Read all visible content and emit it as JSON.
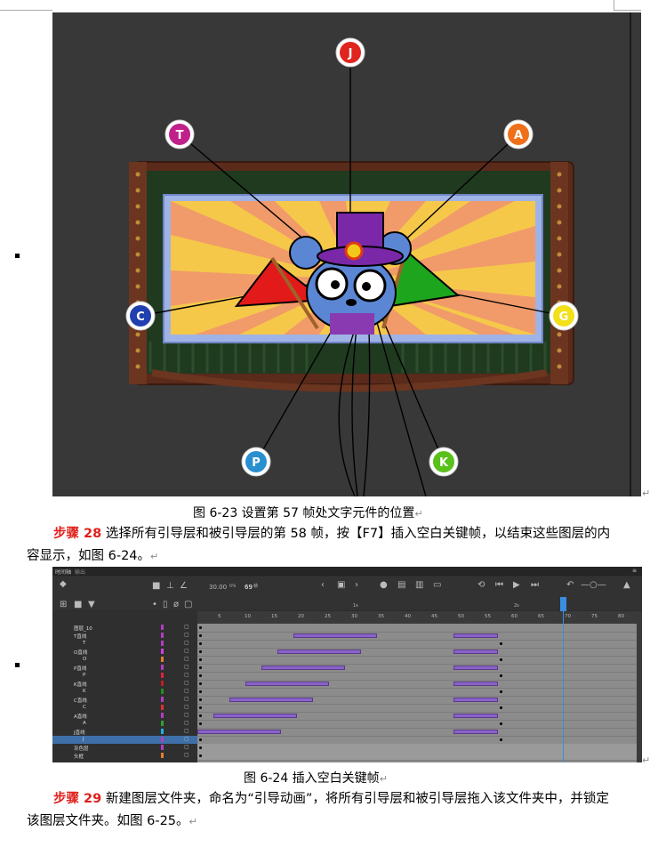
{
  "figure1": {
    "caption": "图 6-23 设置第 57 帧处文字元件的位置",
    "letters": [
      "J",
      "T",
      "A",
      "C",
      "G",
      "P",
      "K"
    ]
  },
  "step28": {
    "label": "步骤 28",
    "text": "选择所有引导层和被引导层的第 58 帧，按【F7】插入空白关键帧，以结束这些图层的内容显示，如图 6-24。"
  },
  "figure2": {
    "caption": "图 6-24 插入空白关键帧",
    "tabs": [
      "时间轴",
      "输出"
    ],
    "fps": "30.00",
    "fps_unit": "FPS",
    "frame": "69",
    "frame_unit": "帧",
    "ruler": [
      "5",
      "10",
      "15",
      "20",
      "25",
      "30",
      "35",
      "40",
      "45",
      "50",
      "55",
      "60",
      "65",
      "70",
      "75",
      "80"
    ],
    "sec_marks": [
      "1s",
      "2s"
    ],
    "layers": [
      {
        "name": "图层_10",
        "color": "#b040c0"
      },
      {
        "name": "T直线",
        "color": "#b040c0"
      },
      {
        "name": "T",
        "color": "#b040c0"
      },
      {
        "name": "O直线",
        "color": "#d040e0"
      },
      {
        "name": "O",
        "color": "#e08030"
      },
      {
        "name": "P直线",
        "color": "#b040c0"
      },
      {
        "name": "P",
        "color": "#e02040"
      },
      {
        "name": "K直线",
        "color": "#c02020"
      },
      {
        "name": "K",
        "color": "#209020"
      },
      {
        "name": "C直线",
        "color": "#b040c0"
      },
      {
        "name": "C",
        "color": "#e03030"
      },
      {
        "name": "A直线",
        "color": "#b040c0"
      },
      {
        "name": "A",
        "color": "#30a030"
      },
      {
        "name": "J直线",
        "color": "#20b0e0"
      },
      {
        "name": "J",
        "color": "#b040c0"
      },
      {
        "name": "灰色层",
        "color": "#b040c0"
      },
      {
        "name": "头框",
        "color": "#e08030"
      }
    ]
  },
  "step29": {
    "label": "步骤 29",
    "text": "新建图层文件夹，命名为“引导动画”，将所有引导层和被引导层拖入该文件夹中，并锁定该图层文件夹。如图 6-25。"
  }
}
